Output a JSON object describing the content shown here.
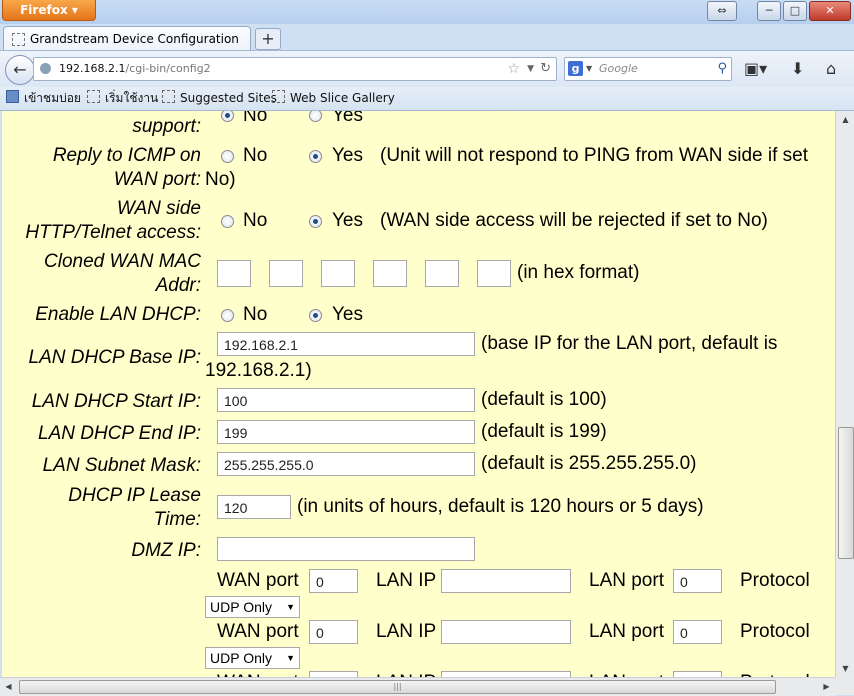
{
  "browser": {
    "app_button": "Firefox",
    "tab_title": "Grandstream Device Configuration",
    "new_tab": "+",
    "url_host": "192.168.2.1",
    "url_path": "/cgi-bin/config2",
    "search_placeholder": "Google",
    "window_controls": {
      "restore_icon": "restore-icon",
      "minimize": "─",
      "maximize": "□",
      "close": "✕"
    }
  },
  "bookmarks": [
    {
      "label": "เข้าชมบ่อย",
      "icon": "bookmarks-icon"
    },
    {
      "label": "เริ่มใช้งาน",
      "icon": "page-icon"
    },
    {
      "label": "Suggested Sites",
      "icon": "page-icon"
    },
    {
      "label": "Web Slice Gallery",
      "icon": "page-icon"
    }
  ],
  "form": {
    "support_label": "support:",
    "no": "No",
    "yes": "Yes",
    "icmp_label_1": "Reply to ICMP on",
    "icmp_label_2": "WAN port:",
    "icmp_note": "(Unit will not respond to PING from WAN side if set",
    "icmp_note_cont": "No)",
    "http_label_1": "WAN side",
    "http_label_2": "HTTP/Telnet access:",
    "http_note": "(WAN side access will be rejected if set to No)",
    "mac_label_1": "Cloned WAN MAC",
    "mac_label_2": "Addr:",
    "mac_note": "(in hex format)",
    "lan_dhcp_label": "Enable LAN DHCP:",
    "base_ip_label": "LAN DHCP Base IP:",
    "base_ip_value": "192.168.2.1",
    "base_ip_note": "(base IP for the LAN port, default is",
    "base_ip_note_cont": "192.168.2.1)",
    "start_ip_label": "LAN DHCP Start IP:",
    "start_ip_value": "100",
    "start_ip_note": "(default is 100)",
    "end_ip_label": "LAN DHCP End IP:",
    "end_ip_value": "199",
    "end_ip_note": "(default is 199)",
    "subnet_label": "LAN Subnet Mask:",
    "subnet_value": "255.255.255.0",
    "subnet_note": "(default is 255.255.255.0)",
    "lease_label_1": "DHCP IP Lease",
    "lease_label_2": "Time:",
    "lease_value": "120",
    "lease_note": "(in units of hours, default is 120 hours or 5 days)",
    "dmz_label": "DMZ IP:",
    "dmz_value": "",
    "forward": {
      "wan_port_label": "WAN port",
      "lan_ip_label": "LAN IP",
      "lan_port_label": "LAN port",
      "protocol_label": "Protocol",
      "rows": [
        {
          "wan_port": "0",
          "lan_ip": "",
          "lan_port": "0",
          "protocol": "UDP Only"
        },
        {
          "wan_port": "0",
          "lan_ip": "",
          "lan_port": "0",
          "protocol": "UDP Only"
        }
      ]
    }
  },
  "selection": {
    "support": "no",
    "icmp": "yes",
    "http": "yes",
    "lan_dhcp": "yes"
  }
}
